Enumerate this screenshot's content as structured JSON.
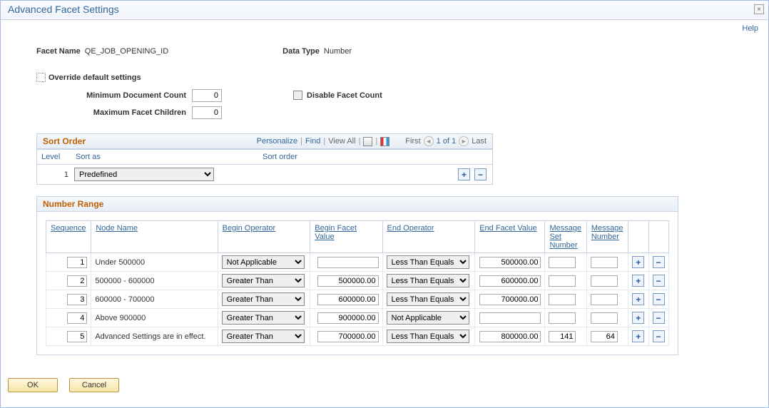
{
  "window": {
    "title": "Advanced Facet Settings"
  },
  "help": "Help",
  "facet": {
    "name_label": "Facet Name",
    "name_value": "QE_JOB_OPENING_ID",
    "datatype_label": "Data Type",
    "datatype_value": "Number"
  },
  "override": {
    "label": "Override default settings",
    "min_label": "Minimum Document Count",
    "min_value": "0",
    "max_label": "Maximum Facet Children",
    "max_value": "0",
    "disable_label": "Disable Facet Count"
  },
  "sort": {
    "title": "Sort Order",
    "links": {
      "personalize": "Personalize",
      "find": "Find",
      "viewall": "View All"
    },
    "nav": {
      "first": "First",
      "range": "1 of 1",
      "last": "Last"
    },
    "headers": {
      "level": "Level",
      "sortas": "Sort as",
      "order": "Sort order"
    },
    "rows": [
      {
        "level": "1",
        "sortas": "Predefined"
      }
    ]
  },
  "range": {
    "title": "Number Range",
    "headers": {
      "sequence": "Sequence",
      "node": "Node Name",
      "begin_op": "Begin Operator",
      "begin_val": "Begin Facet Value",
      "end_op": "End Operator",
      "end_val": "End Facet Value",
      "msg_set": "Message Set Number",
      "msg_num": "Message Number"
    },
    "rows": [
      {
        "seq": "1",
        "node": "Under 500000",
        "begin_op": "Not Applicable",
        "begin_val": "",
        "end_op": "Less Than Equals",
        "end_val": "500000.00",
        "msg_set": "",
        "msg_num": ""
      },
      {
        "seq": "2",
        "node": "500000 - 600000",
        "begin_op": "Greater Than",
        "begin_val": "500000.00",
        "end_op": "Less Than Equals",
        "end_val": "600000.00",
        "msg_set": "",
        "msg_num": ""
      },
      {
        "seq": "3",
        "node": "600000 - 700000",
        "begin_op": "Greater Than",
        "begin_val": "600000.00",
        "end_op": "Less Than Equals",
        "end_val": "700000.00",
        "msg_set": "",
        "msg_num": ""
      },
      {
        "seq": "4",
        "node": "Above 900000",
        "begin_op": "Greater Than",
        "begin_val": "900000.00",
        "end_op": "Not Applicable",
        "end_val": "",
        "msg_set": "",
        "msg_num": ""
      },
      {
        "seq": "5",
        "node": "Advanced Settings are in effect.",
        "begin_op": "Greater Than",
        "begin_val": "700000.00",
        "end_op": "Less Than Equals",
        "end_val": "800000.00",
        "msg_set": "141",
        "msg_num": "64"
      }
    ]
  },
  "buttons": {
    "ok": "OK",
    "cancel": "Cancel"
  }
}
